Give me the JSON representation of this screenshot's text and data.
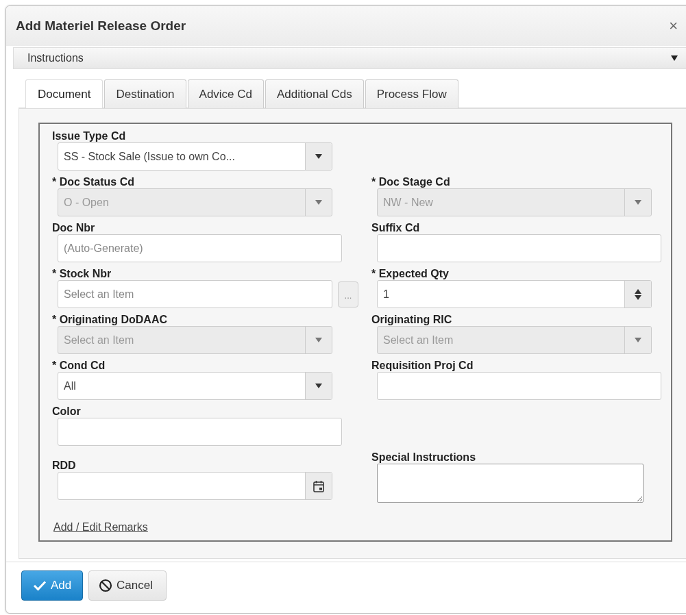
{
  "dialog": {
    "title": "Add Materiel Release Order",
    "close": "×"
  },
  "instructions": {
    "label": "Instructions",
    "expanded": false
  },
  "tabs": [
    {
      "label": "Document",
      "selected": true
    },
    {
      "label": "Destination",
      "selected": false
    },
    {
      "label": "Advice Cd",
      "selected": false
    },
    {
      "label": "Additional Cds",
      "selected": false
    },
    {
      "label": "Process Flow",
      "selected": false
    }
  ],
  "rows": [
    {
      "left": {
        "label": "Issue Type Cd",
        "kind": "select",
        "value": "SS - Stock Sale (Issue to own Co...",
        "disabled": false
      }
    },
    {
      "left": {
        "label": "* Doc Status Cd",
        "kind": "select",
        "value": "O - Open",
        "disabled": true
      },
      "right": {
        "label": "* Doc Stage Cd",
        "kind": "select",
        "value": "NW - New",
        "disabled": true
      }
    },
    {
      "left": {
        "label": "Doc Nbr",
        "kind": "text",
        "placeholder": "(Auto-Generate)"
      },
      "right": {
        "label": "Suffix Cd",
        "kind": "text"
      }
    },
    {
      "left": {
        "label": "* Stock Nbr",
        "kind": "lookup",
        "placeholder": "Select an Item",
        "button": "..."
      },
      "right": {
        "label": "* Expected Qty",
        "kind": "spinner",
        "value": "1"
      }
    },
    {
      "left": {
        "label": "* Originating DoDAAC",
        "kind": "select",
        "placeholder": "Select an Item",
        "disabled": true
      },
      "right": {
        "label": "Originating RIC",
        "kind": "select",
        "placeholder": "Select an Item",
        "disabled": true
      }
    },
    {
      "left": {
        "label": "* Cond Cd",
        "kind": "select",
        "value": "All",
        "disabled": false
      },
      "right": {
        "label": "Requisition Proj Cd",
        "kind": "text"
      }
    },
    {
      "left": {
        "label": "Color",
        "kind": "text"
      }
    },
    {
      "left": {
        "label": "RDD",
        "kind": "date"
      },
      "right": {
        "label": "Special Instructions",
        "kind": "textarea"
      }
    }
  ],
  "remarks_link": "Add / Edit Remarks",
  "buttons": [
    {
      "label": "Add",
      "kind": "primary"
    },
    {
      "label": "Cancel",
      "kind": "cancel"
    }
  ]
}
